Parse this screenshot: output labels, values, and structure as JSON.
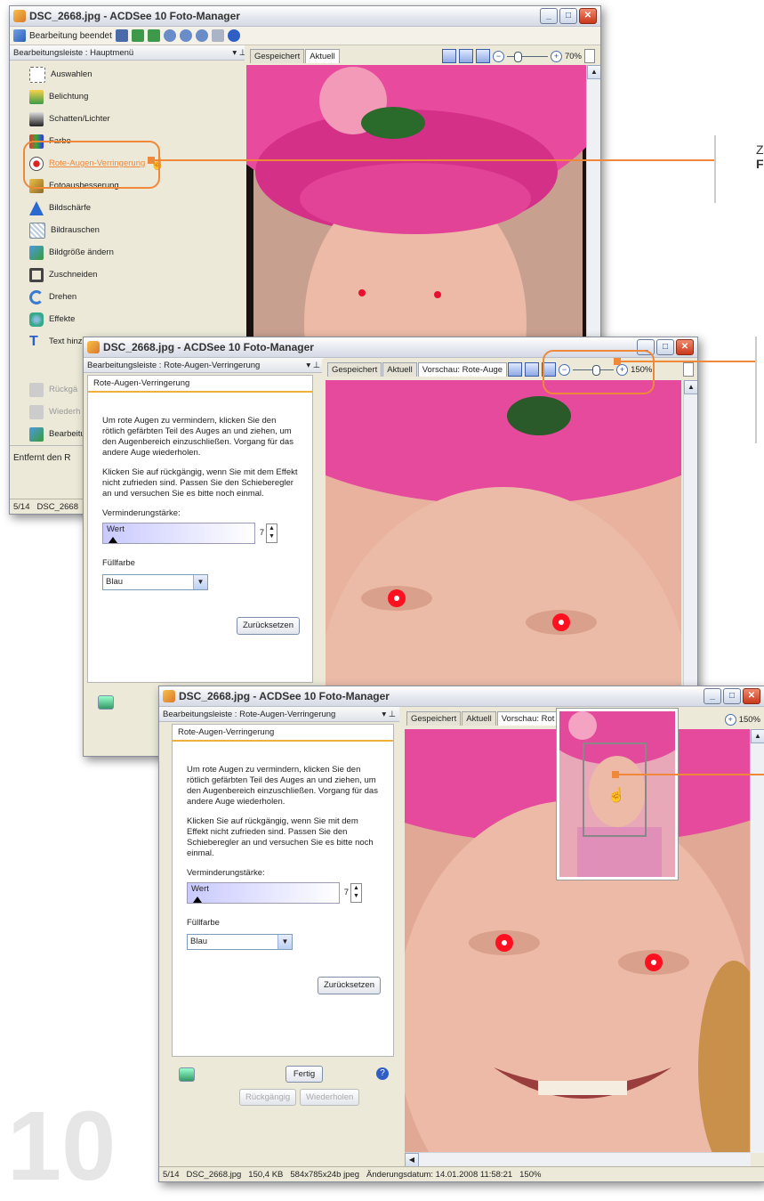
{
  "window1": {
    "title": "DSC_2668.jpg - ACDSee 10 Foto-Manager",
    "toolbar_done": "Bearbeitung beendet",
    "panel_title": "Bearbeitungsleiste : Hauptmenü",
    "tabs": [
      "Gespeichert",
      "Aktuell"
    ],
    "zoom": "70%",
    "menu": [
      {
        "label": "Auswahlen",
        "icon": "selection-icon"
      },
      {
        "label": "Belichtung",
        "icon": "exposure-icon"
      },
      {
        "label": "Schatten/Lichter",
        "icon": "shadow-light-icon"
      },
      {
        "label": "Farbe",
        "icon": "color-icon"
      },
      {
        "label": "Rote-Augen-Verringerung",
        "icon": "red-eye-icon"
      },
      {
        "label": "Fotoausbesserung",
        "icon": "repair-icon"
      },
      {
        "label": "Bildschärfe",
        "icon": "sharpen-icon"
      },
      {
        "label": "Bildrauschen",
        "icon": "noise-icon"
      },
      {
        "label": "Bildgröße ändern",
        "icon": "resize-icon"
      },
      {
        "label": "Zuschneiden",
        "icon": "crop-icon"
      },
      {
        "label": "Drehen",
        "icon": "rotate-icon"
      },
      {
        "label": "Effekte",
        "icon": "effects-icon"
      },
      {
        "label": "Text hinz",
        "icon": "text-icon"
      }
    ],
    "bottom_items": [
      "Rückgä",
      "Wiederh",
      "Bearbeitu"
    ],
    "footer_text": "Entfernt den R",
    "status": [
      "5/14",
      "DSC_2668"
    ]
  },
  "window2": {
    "title": "DSC_2668.jpg - ACDSee 10 Foto-Manager",
    "panel_title": "Bearbeitungsleiste : Rote-Augen-Verringerung",
    "tabs": [
      "Gespeichert",
      "Aktuell",
      "Vorschau: Rote-Auge"
    ],
    "zoom": "150%",
    "section_title": "Rote-Augen-Verringerung",
    "instructions1": "Um rote Augen zu vermindern, klicken Sie den rötlich gefärbten Teil des Auges an und ziehen, um den Augenbereich einzuschließen. Vorgang für das andere Auge wiederholen.",
    "instructions2": "Klicken Sie auf rückgängig, wenn Sie mit dem Effekt nicht zufrieden sind. Passen Sie den Schieberegler an und versuchen Sie es bitte noch einmal.",
    "strength_label": "Verminderungstärke:",
    "value_label": "Wert",
    "value": "7",
    "fill_label": "Füllfarbe",
    "fill_value": "Blau",
    "reset_button": "Zurücksetzen"
  },
  "window3": {
    "title": "DSC_2668.jpg - ACDSee 10 Foto-Manager",
    "panel_title": "Bearbeitungsleiste : Rote-Augen-Verringerung",
    "tabs": [
      "Gespeichert",
      "Aktuell",
      "Vorschau: Rot"
    ],
    "zoom": "150%",
    "section_title": "Rote-Augen-Verringerung",
    "instructions1": "Um rote Augen zu vermindern, klicken Sie den rötlich gefärbten Teil des Auges an und ziehen, um den Augenbereich einzuschließen. Vorgang für das andere Auge wiederholen.",
    "instructions2": "Klicken Sie auf rückgängig, wenn Sie mit dem Effekt nicht zufrieden sind. Passen Sie den Schieberegler an und versuchen Sie es bitte noch einmal.",
    "strength_label": "Verminderungstärke:",
    "value_label": "Wert",
    "value": "7",
    "fill_label": "Füllfarbe",
    "fill_value": "Blau",
    "reset_button": "Zurücksetzen",
    "done_button": "Fertig",
    "undo_button": "Rückgängig",
    "redo_button": "Wiederholen",
    "status": [
      "5/14",
      "DSC_2668.jpg",
      "150,4 KB",
      "584x785x24b jpeg",
      "Änderungsdatum: 14.01.2008 11:58:21",
      "150%"
    ]
  },
  "side_caption": {
    "line1": "Z",
    "line2": "F"
  },
  "page_number": "10",
  "colors": {
    "accent": "#f0883a",
    "hat_pink": "#e8409a",
    "skin": "#eab2a0"
  }
}
